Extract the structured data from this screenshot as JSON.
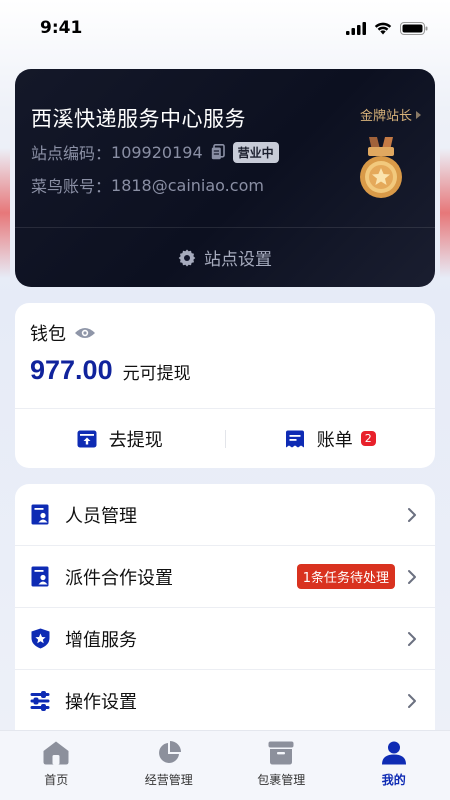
{
  "status_bar": {
    "time": "9:41"
  },
  "station": {
    "name": "西溪快递服务中心服务",
    "gold_tag": "金牌站长",
    "code_label": "站点编码：",
    "code_value": "109920194",
    "status": "营业中",
    "account_label": "菜鸟账号：",
    "account_value": "1818@cainiao.com",
    "settings_label": "站点设置"
  },
  "wallet": {
    "title": "钱包",
    "amount": "977.00",
    "amount_label": "元可提现",
    "withdraw_label": "去提现",
    "bill_label": "账单",
    "bill_badge": "2"
  },
  "menu": {
    "items": [
      {
        "label": "人员管理",
        "icon": "staff-icon"
      },
      {
        "label": "派件合作设置",
        "icon": "delivery-icon",
        "badge": "1条任务待处理"
      },
      {
        "label": "增值服务",
        "icon": "shield-star-icon"
      },
      {
        "label": "操作设置",
        "icon": "sliders-icon"
      }
    ]
  },
  "tabs": [
    {
      "label": "首页",
      "icon": "home-icon"
    },
    {
      "label": "经营管理",
      "icon": "pie-chart-icon"
    },
    {
      "label": "包裹管理",
      "icon": "package-icon"
    },
    {
      "label": "我的",
      "icon": "user-icon",
      "active": true
    }
  ],
  "colors": {
    "accent": "#0e2bb4",
    "amount": "#10239c",
    "gold": "#d7b27a",
    "badge_red": "#e8212b",
    "task_badge": "#d9321f"
  }
}
